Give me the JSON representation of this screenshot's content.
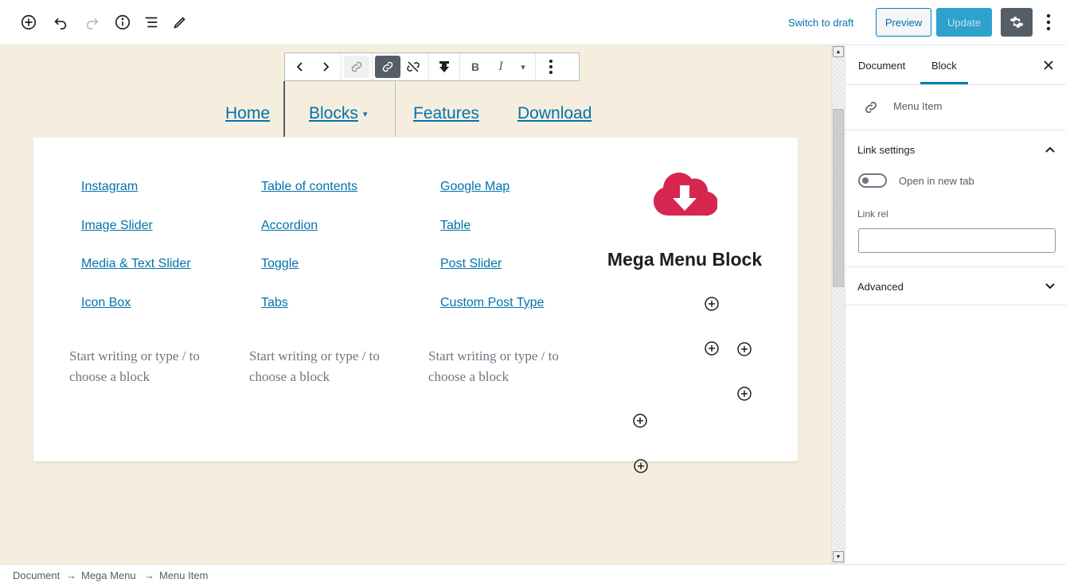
{
  "header": {
    "switch_to_draft": "Switch to draft",
    "preview": "Preview",
    "update": "Update",
    "icons": [
      "add-block-icon",
      "undo-icon",
      "redo-icon",
      "info-icon",
      "list-view-icon",
      "edit-icon",
      "gear-icon",
      "more-vertical-icon"
    ]
  },
  "nav": {
    "items": [
      {
        "label": "Home"
      },
      {
        "label": "Blocks",
        "caret": "▾"
      },
      {
        "label": "Features"
      },
      {
        "label": "Download"
      }
    ]
  },
  "block_toolbar": {
    "bold": "B",
    "italic": "I",
    "dropdown": "▾"
  },
  "mega_menu": {
    "columns": [
      {
        "links": [
          "Instagram",
          "Image Slider",
          "Media & Text Slider",
          "Icon Box"
        ],
        "placeholder": "Start writing or type / to choose a block"
      },
      {
        "links": [
          "Table of contents",
          "Accordion",
          "Toggle",
          "Tabs"
        ],
        "placeholder": "Start writing or type / to choose a block"
      },
      {
        "links": [
          "Google Map",
          "Table",
          "Post Slider",
          "Custom Post Type"
        ],
        "placeholder": "Start writing or type / to choose a block"
      }
    ],
    "feature_title": "Mega Menu Block",
    "accent_color": "#d6264f"
  },
  "sidebar": {
    "tabs": [
      "Document",
      "Block"
    ],
    "active_tab": "Block",
    "block_name": "Menu Item",
    "link_settings_title": "Link settings",
    "open_new_tab_label": "Open in new tab",
    "open_new_tab_on": false,
    "link_rel_label": "Link rel",
    "link_rel_value": "",
    "advanced_title": "Advanced"
  },
  "breadcrumbs": {
    "items": [
      "Document",
      "Mega Menu",
      "Menu Item"
    ],
    "separator": "→"
  }
}
